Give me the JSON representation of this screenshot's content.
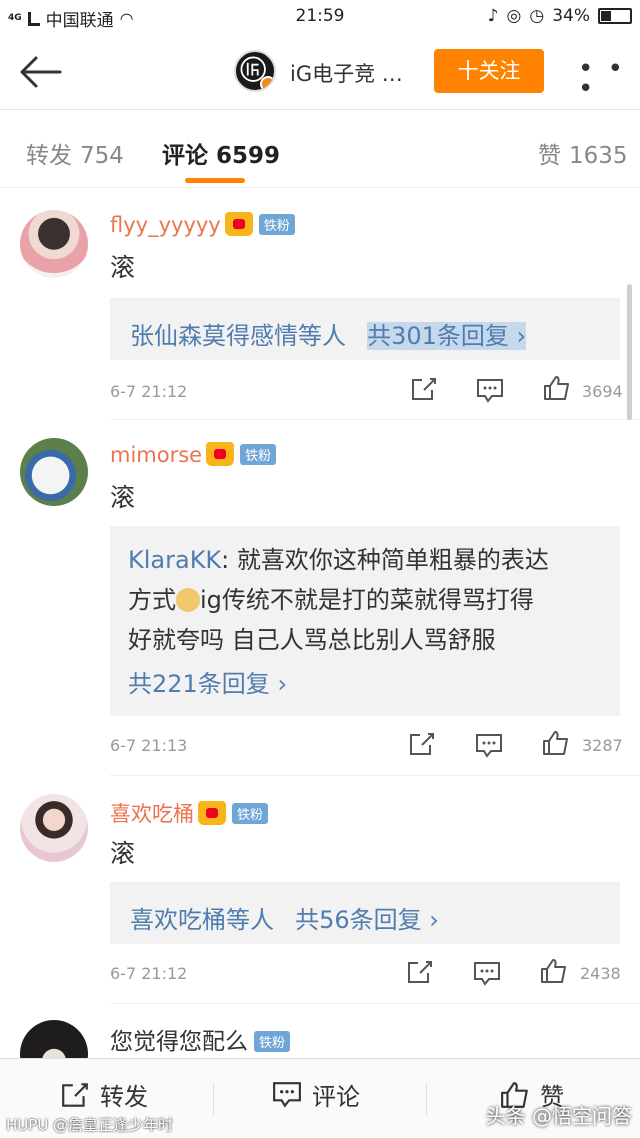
{
  "status_bar": {
    "network": "4G",
    "carrier": "中国联通",
    "time": "21:59",
    "battery": "34%"
  },
  "nav": {
    "title": "iG电子竞 …",
    "follow_label": "十关注",
    "more_label": "• • •"
  },
  "tabs": [
    {
      "label": "转发",
      "count": "754"
    },
    {
      "label": "评论",
      "count": "6599"
    },
    {
      "label": "赞",
      "count": "1635"
    }
  ],
  "comments": [
    {
      "username": "flyy_yyyyy",
      "fan_badge": "铁粉",
      "text": "滚",
      "reply_prefix": "张仙森莫得感情等人",
      "reply_count": "共301条回复",
      "time": "6-7 21:12",
      "likes": "3694"
    },
    {
      "username": "mimorse",
      "fan_badge": "铁粉",
      "text": "滚",
      "reply_name": "KlaraKK",
      "reply_text_1": ": 就喜欢你这种简单粗暴的表达",
      "reply_text_2": "方式",
      "reply_text_3": "ig传统不就是打的菜就得骂打得",
      "reply_text_4": "好就夸吗 自己人骂总比别人骂舒服",
      "reply_count": "共221条回复",
      "time": "6-7 21:13",
      "likes": "3287"
    },
    {
      "username": "喜欢吃桶",
      "fan_badge": "铁粉",
      "text": "滚",
      "reply_prefix": "喜欢吃桶等人",
      "reply_count": "共56条回复",
      "time": "6-7 21:12",
      "likes": "2438"
    },
    {
      "text": "您觉得您配么",
      "fan_badge": "铁粉"
    }
  ],
  "bottom_bar": {
    "repost": "转发",
    "comment": "评论",
    "like": "赞"
  },
  "watermark": {
    "left": "HUPU @詹皇正逢少年时",
    "right": "头条 @悟空问答"
  },
  "colors": {
    "accent": "#ff8200",
    "username": "#eb7350",
    "link": "#507daf"
  }
}
